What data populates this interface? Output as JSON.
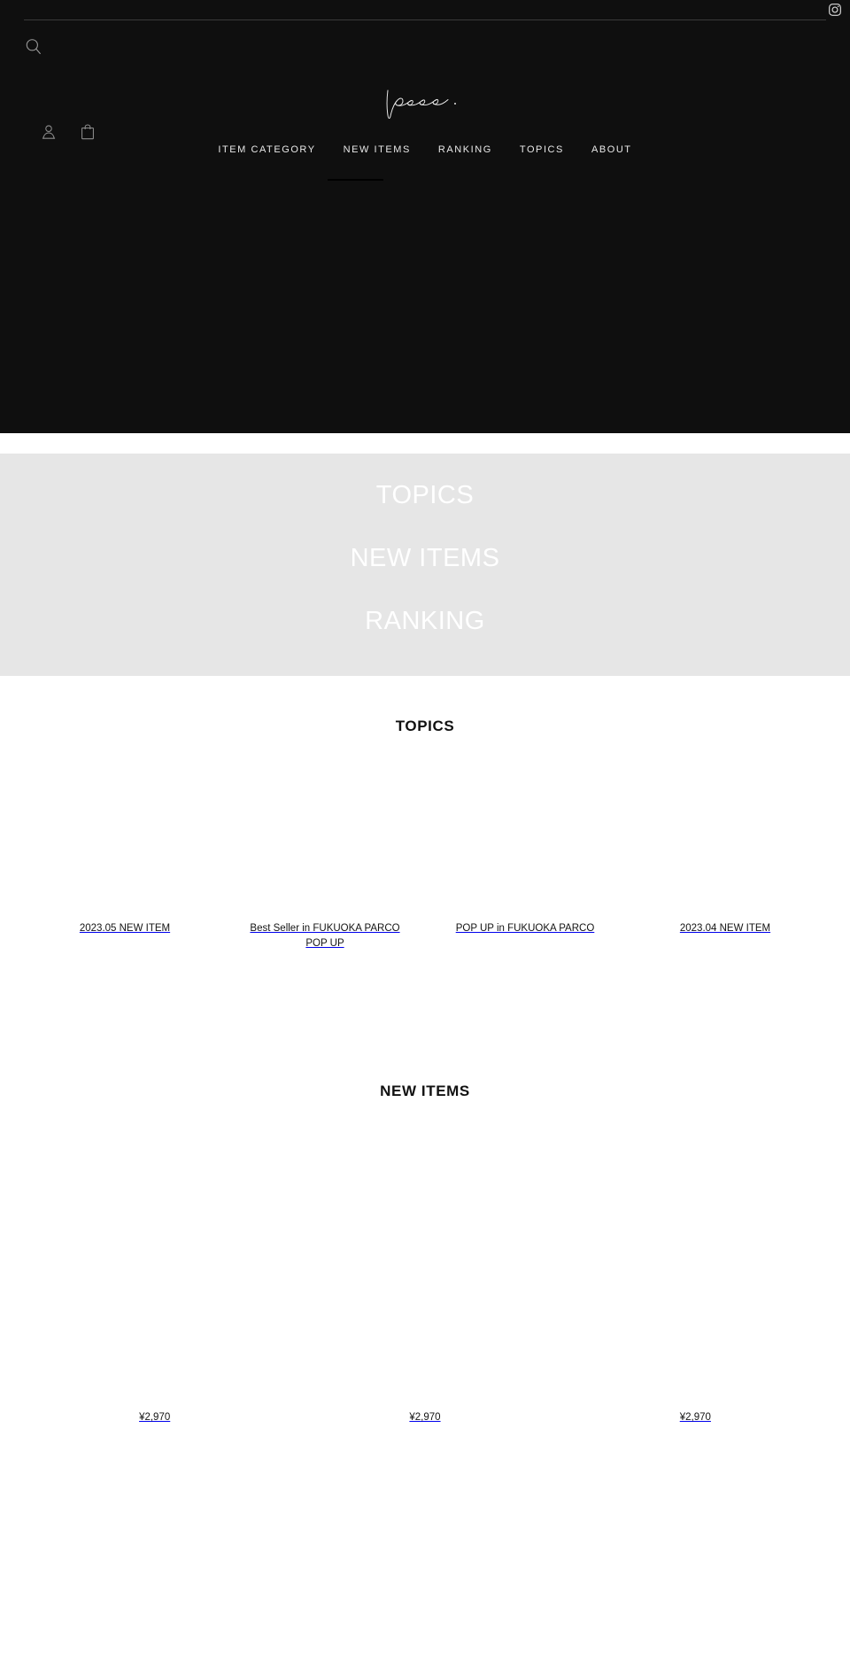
{
  "site": {
    "brand_logo_alt": "pour.",
    "background_dark": "#0f0f0f",
    "background_gray": "#e6e6e6",
    "text_light": "#e8e8e8"
  },
  "header": {
    "instagram_label": "Instagram",
    "search_label": "Search",
    "account_label": "Account",
    "cart_label": "Cart",
    "nav": [
      {
        "label": "ITEM CATEGORY"
      },
      {
        "label": "NEW ITEMS"
      },
      {
        "label": "RANKING"
      },
      {
        "label": "TOPICS"
      },
      {
        "label": "ABOUT"
      }
    ]
  },
  "banner_links": [
    {
      "label": "TOPICS"
    },
    {
      "label": "NEW ITEMS"
    },
    {
      "label": "RANKING"
    }
  ],
  "topics": {
    "heading": "TOPICS",
    "items": [
      {
        "label": "2023.05 NEW ITEM"
      },
      {
        "label": "Best Seller in FUKUOKA PARCO POP UP"
      },
      {
        "label": "POP UP in FUKUOKA PARCO"
      },
      {
        "label": "2023.04 NEW ITEM"
      }
    ]
  },
  "new_items": {
    "heading": "NEW ITEMS",
    "items": [
      {
        "title": "",
        "price": "¥2,970"
      },
      {
        "title": "",
        "price": "¥2,970"
      },
      {
        "title": "",
        "price": "¥2,970"
      }
    ]
  }
}
